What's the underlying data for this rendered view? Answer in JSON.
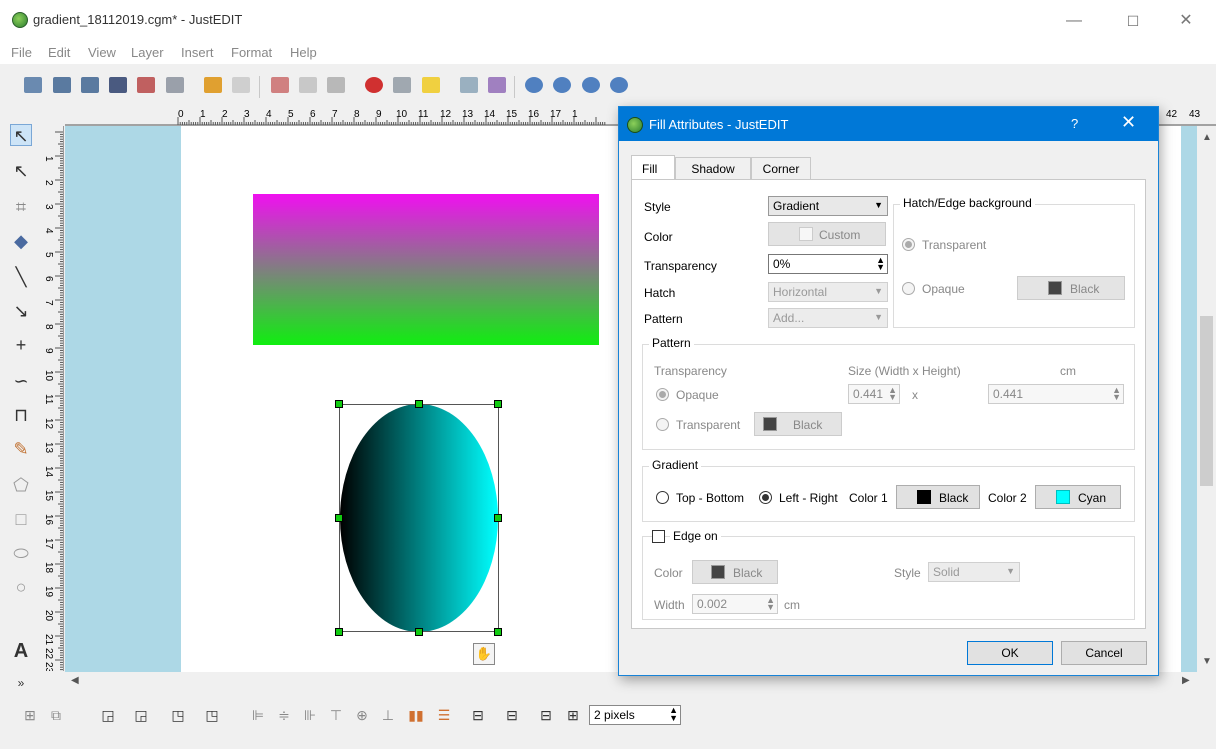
{
  "window": {
    "title": "gradient_18112019.cgm* - JustEDIT",
    "min": "—",
    "max": "☐",
    "close": "✕"
  },
  "menu": [
    "File",
    "Edit",
    "View",
    "Layer",
    "Insert",
    "Format",
    "Help"
  ],
  "rulers": {
    "h_ticks": [
      "0",
      "1",
      "2",
      "3",
      "4",
      "5",
      "6",
      "7",
      "8",
      "9",
      "10",
      "11",
      "12",
      "13",
      "14",
      "15",
      "16",
      "17",
      "1",
      "42",
      "43"
    ],
    "v_ticks": [
      "1",
      "2",
      "3",
      "4",
      "5",
      "6",
      "7",
      "8",
      "9",
      "10",
      "11",
      "12",
      "13",
      "14",
      "15",
      "16",
      "17",
      "18",
      "19",
      "20",
      "21",
      "22",
      "23"
    ]
  },
  "bottombar": {
    "line_width": "2 pixels"
  },
  "dialog": {
    "title": "Fill Attributes - JustEDIT",
    "help": "?",
    "close": "✕",
    "tabs": [
      "Fill",
      "Shadow",
      "Corner"
    ],
    "fill": {
      "style_label": "Style",
      "style_value": "Gradient",
      "color_label": "Color",
      "color_value": "Custom",
      "transparency_label": "Transparency",
      "transparency_value": "0%",
      "hatch_label": "Hatch",
      "hatch_value": "Horizontal",
      "pattern_label": "Pattern",
      "pattern_value": "Add..."
    },
    "hatch_bg": {
      "title": "Hatch/Edge background",
      "transparent": "Transparent",
      "opaque": "Opaque",
      "color": "Black"
    },
    "pattern": {
      "title": "Pattern",
      "transparency": "Transparency",
      "size_label": "Size (Width x Height)",
      "unit": "cm",
      "opaque": "Opaque",
      "transparent": "Transparent",
      "width": "0.441",
      "x": "x",
      "height": "0.441",
      "color": "Black"
    },
    "gradient": {
      "title": "Gradient",
      "top_bottom": "Top - Bottom",
      "left_right": "Left - Right",
      "color1_label": "Color 1",
      "color1": "Black",
      "color2_label": "Color 2",
      "color2": "Cyan"
    },
    "edge": {
      "title": "Edge on",
      "color_label": "Color",
      "color": "Black",
      "style_label": "Style",
      "style": "Solid",
      "width_label": "Width",
      "width": "0.002",
      "unit": "cm"
    },
    "ok": "OK",
    "cancel": "Cancel"
  }
}
